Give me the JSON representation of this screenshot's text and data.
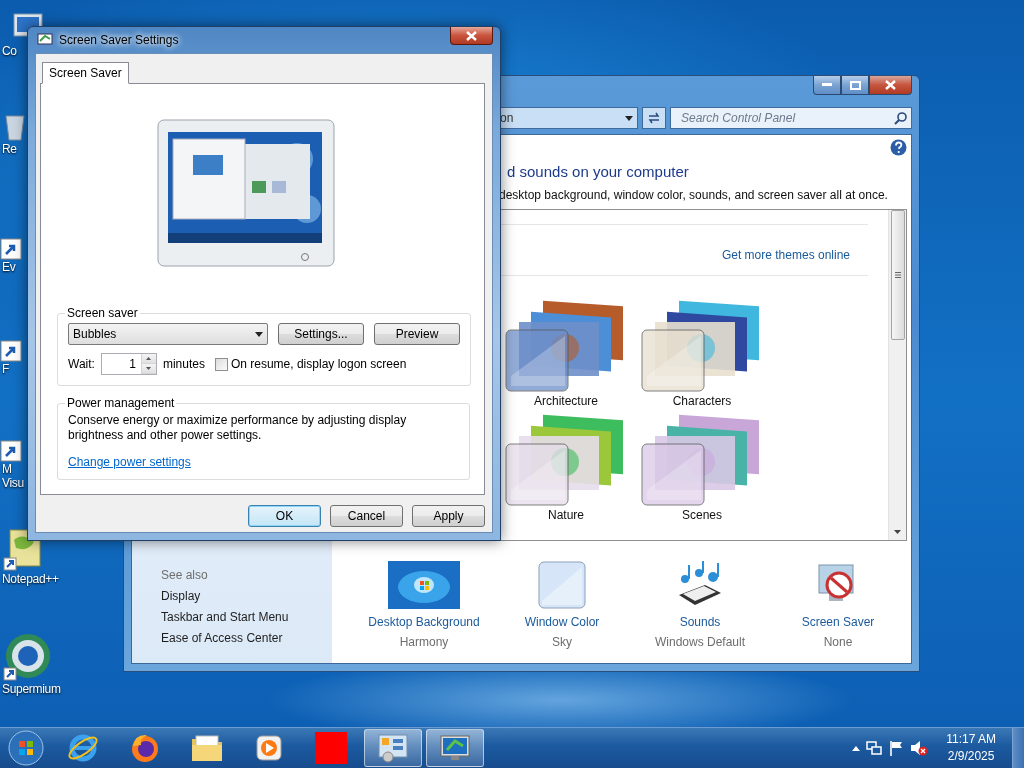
{
  "desktop_icons": [
    {
      "kind": "computer",
      "lines": [
        "Co"
      ]
    },
    {
      "kind": "recycle",
      "lines": [
        "Re"
      ]
    },
    {
      "kind": "shortcut",
      "lines": [
        "Ev"
      ]
    },
    {
      "kind": "shortcut",
      "lines": [
        "F"
      ]
    },
    {
      "kind": "shortcut",
      "lines": [
        "M",
        "Visu"
      ]
    },
    {
      "kind": "notepad",
      "lines": [
        "Notepad++"
      ]
    },
    {
      "kind": "browser",
      "lines": [
        "Supermium"
      ]
    }
  ],
  "control_panel": {
    "address": "on",
    "search": {
      "placeholder": "Search Control Panel"
    },
    "heading": "d sounds on your computer",
    "subheading": "desktop background, window color, sounds, and screen saver all at once.",
    "link": "Get more themes online",
    "themes": [
      {
        "name": "Architecture"
      },
      {
        "name": "Characters"
      },
      {
        "name": "Nature"
      },
      {
        "name": "Scenes"
      }
    ],
    "see_also": {
      "title": "See also",
      "links": [
        "Display",
        "Taskbar and Start Menu",
        "Ease of Access Center"
      ]
    },
    "settings": [
      {
        "kind": "wallpaper",
        "label": "Desktop Background",
        "value": "Harmony"
      },
      {
        "kind": "color",
        "label": "Window Color",
        "value": "Sky"
      },
      {
        "kind": "sounds",
        "label": "Sounds",
        "value": "Windows Default"
      },
      {
        "kind": "screensaver",
        "label": "Screen Saver",
        "value": "None"
      }
    ]
  },
  "dialog": {
    "title": "Screen Saver Settings",
    "tabs": [
      {
        "label": "Screen Saver",
        "selected": true
      }
    ],
    "screen_saver": {
      "label": "Screen saver",
      "value": "Bubbles",
      "buttons": [
        "Settings...",
        "Preview"
      ],
      "wait_label": "Wait:",
      "wait_value": "1",
      "wait_unit": "minutes",
      "logon": {
        "label": "On resume, display logon screen",
        "checked": false
      }
    },
    "power": {
      "label": "Power management",
      "text": "Conserve energy or maximize performance by adjusting display brightness and other power settings.",
      "link": "Change power settings"
    },
    "buttons": [
      {
        "label": "OK",
        "default": true
      },
      {
        "label": "Cancel",
        "default": false
      },
      {
        "label": "Apply",
        "default": false
      }
    ]
  },
  "taskbar": {
    "apps": [
      {
        "kind": "ie",
        "active": false
      },
      {
        "kind": "firefox",
        "active": false
      },
      {
        "kind": "explorer",
        "active": false
      },
      {
        "kind": "media",
        "active": false
      },
      {
        "kind": "red",
        "active": false
      },
      {
        "kind": "control-panel",
        "active": true
      },
      {
        "kind": "screen-saver",
        "active": true
      }
    ],
    "clock": {
      "time": "11:17 AM",
      "date": "2/9/2025"
    }
  }
}
